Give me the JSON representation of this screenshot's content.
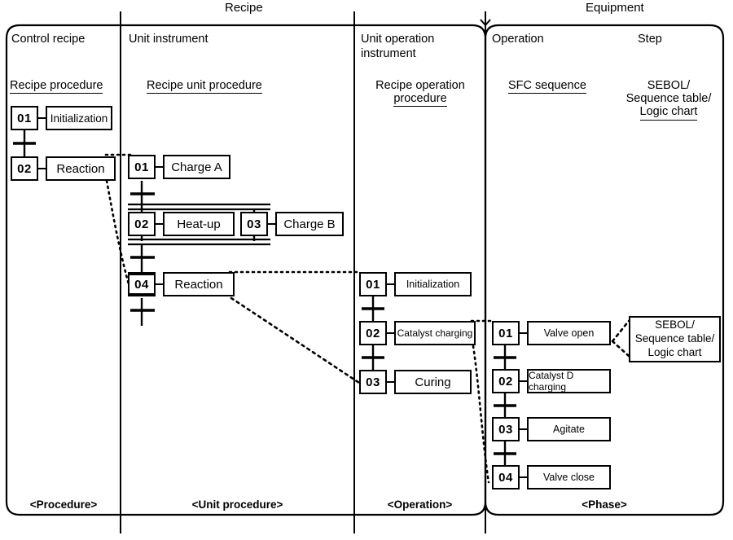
{
  "groups": [
    {
      "id": "recipe",
      "label": "Recipe"
    },
    {
      "id": "equipment",
      "label": "Equipment"
    }
  ],
  "columns": [
    {
      "id": "control-recipe",
      "header": "Control recipe",
      "subtitle": "Recipe procedure",
      "footer": "<Procedure>"
    },
    {
      "id": "unit-instrument",
      "header": "Unit instrument",
      "subtitle": "Recipe unit procedure",
      "footer": "<Unit procedure>"
    },
    {
      "id": "unit-operation-instrument",
      "header_line1": "Unit operation",
      "header_line2": "instrument",
      "subtitle_line1": "Recipe operation",
      "subtitle_line2": "procedure",
      "footer": "<Operation>"
    },
    {
      "id": "operation",
      "header": "Operation",
      "subtitle": "SFC sequence",
      "footer": "<Phase>"
    },
    {
      "id": "step",
      "header": "Step",
      "subtitle_line1": "SEBOL/",
      "subtitle_line2": "Sequence table/",
      "subtitle_line3": "Logic chart"
    }
  ],
  "procedure_steps": [
    {
      "num": "01",
      "action": "Initialization"
    },
    {
      "num": "02",
      "action": "Reaction"
    }
  ],
  "unit_procedure_steps": [
    {
      "num": "01",
      "action": "Charge A"
    },
    {
      "num": "02",
      "action": "Heat-up"
    },
    {
      "num": "03",
      "action": "Charge B"
    },
    {
      "num": "04",
      "action": "Reaction",
      "macro": true
    }
  ],
  "operation_steps": [
    {
      "num": "01",
      "action": "Initialization"
    },
    {
      "num": "02",
      "action": "Catalyst charging"
    },
    {
      "num": "03",
      "action": "Curing"
    }
  ],
  "phase_steps": [
    {
      "num": "01",
      "action": "Valve open"
    },
    {
      "num": "02",
      "action": "Catalyst D charging"
    },
    {
      "num": "03",
      "action": "Agitate"
    },
    {
      "num": "04",
      "action": "Valve close"
    }
  ],
  "detail_box": {
    "line1": "SEBOL/",
    "line2": "Sequence table/",
    "line3": "Logic chart"
  },
  "colors": {
    "line": "#000000",
    "background": "#ffffff"
  }
}
